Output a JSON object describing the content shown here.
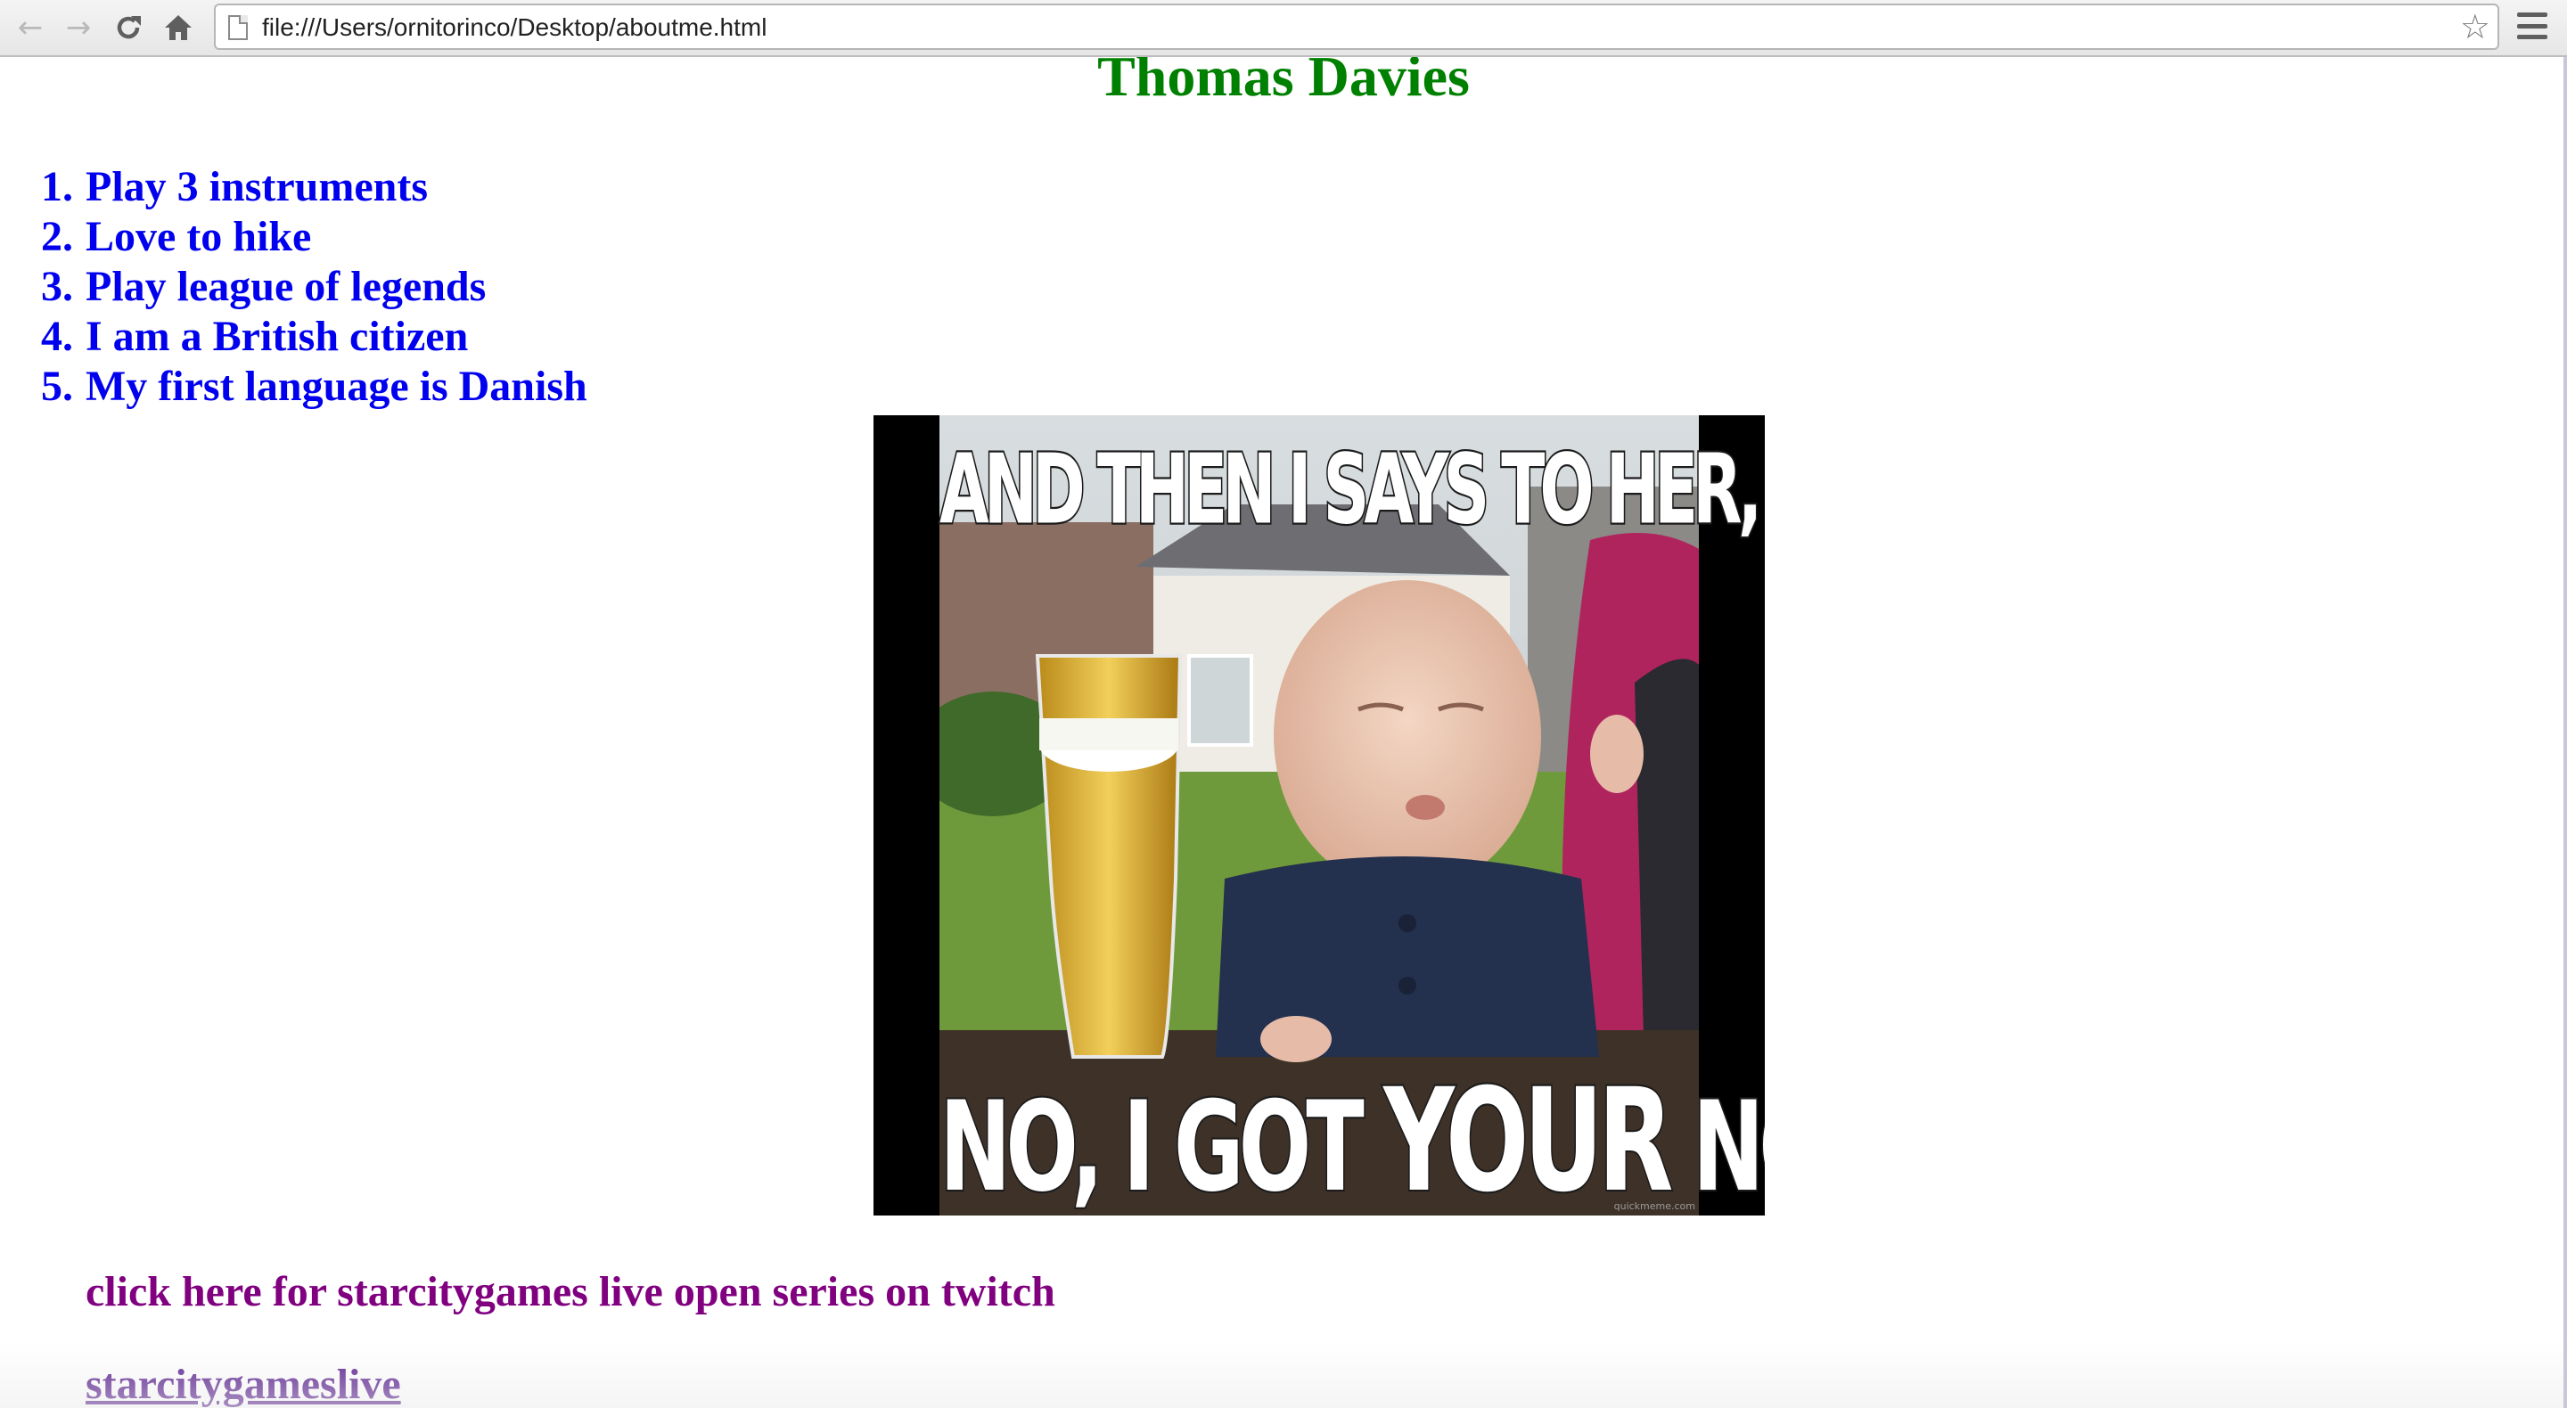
{
  "browser": {
    "url": "file:///Users/ornitorinco/Desktop/aboutme.html",
    "icons": {
      "back": "back-arrow-icon",
      "forward": "forward-arrow-icon",
      "reload": "reload-icon",
      "home": "home-icon",
      "page": "page-icon",
      "bookmark": "star-icon",
      "menu": "hamburger-menu-icon"
    }
  },
  "page": {
    "title": "Thomas Davies",
    "facts": [
      {
        "num": "1.",
        "text": "Play 3 instruments"
      },
      {
        "num": "2.",
        "text": "Love to hike"
      },
      {
        "num": "3.",
        "text": "Play league of legends"
      },
      {
        "num": "4.",
        "text": "I am a British citizen"
      },
      {
        "num": "5.",
        "text": "My first language is Danish"
      }
    ],
    "meme": {
      "top_text": "AND THEN I SAYS TO HER, I SAYS,",
      "bottom_text_a": "NO, I GOT ",
      "bottom_text_b": "YOUR",
      "bottom_text_c": " NOSE.",
      "watermark": "quickmeme.com"
    },
    "twitch_link": "click here for starcitygames live open series on twitch",
    "stream_link": "starcitygameslive"
  },
  "colors": {
    "title": "#008000",
    "facts": "#0000ee",
    "twitch_link": "#800080",
    "stream_link": "#551a8b"
  }
}
